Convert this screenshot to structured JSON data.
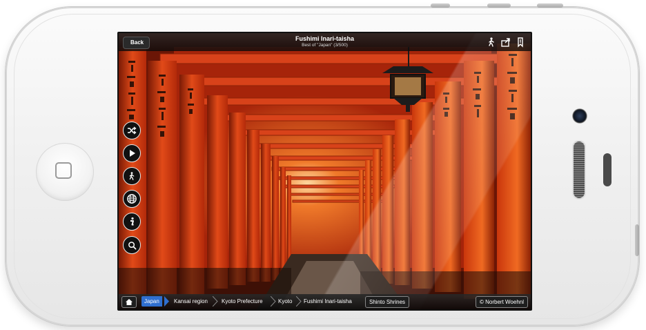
{
  "header": {
    "back_label": "Back",
    "title": "Fushimi Inari-taisha",
    "subtitle": "Best of \"Japan\" (3/500)"
  },
  "toolbar_icons": [
    "walking-person-icon",
    "share-icon",
    "bookmark-icon"
  ],
  "side_tools": [
    {
      "name": "shuffle-icon",
      "glyph": "⤨"
    },
    {
      "name": "play-icon",
      "glyph": "▶"
    },
    {
      "name": "walking-person-icon",
      "glyph": "🚶"
    },
    {
      "name": "globe-icon",
      "glyph": "🌐"
    },
    {
      "name": "info-icon",
      "glyph": "i"
    },
    {
      "name": "search-icon",
      "glyph": "⌕"
    }
  ],
  "breadcrumb": {
    "items": [
      "Japan",
      "Kansai region",
      "Kyoto Prefecture",
      "Kyoto",
      "Fushimi Inari-taisha"
    ],
    "active_index": 0
  },
  "tag": "Shinto Shrines",
  "credit": "© Norbert Woehnl",
  "colors": {
    "accent": "#2f6fd0",
    "torii": "#e0451b"
  }
}
